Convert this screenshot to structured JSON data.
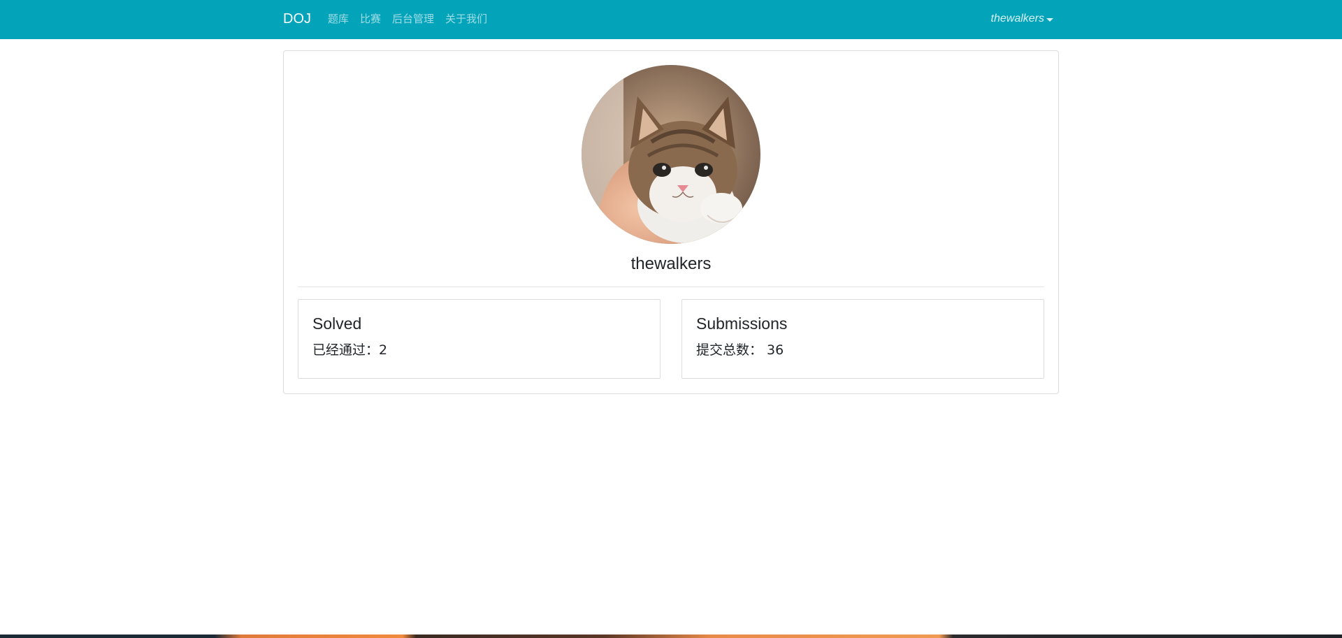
{
  "navbar": {
    "brand": "DOJ",
    "links": [
      {
        "label": "题库"
      },
      {
        "label": "比赛"
      },
      {
        "label": "后台管理"
      },
      {
        "label": "关于我们"
      }
    ],
    "user": "thewalkers",
    "background": "#03a4ba"
  },
  "profile": {
    "avatar_icon": "kitten-avatar-image",
    "username": "thewalkers",
    "solved": {
      "title": "Solved",
      "text": "已经通过：2"
    },
    "submissions": {
      "title": "Submissions",
      "text": "提交总数： 36"
    }
  }
}
